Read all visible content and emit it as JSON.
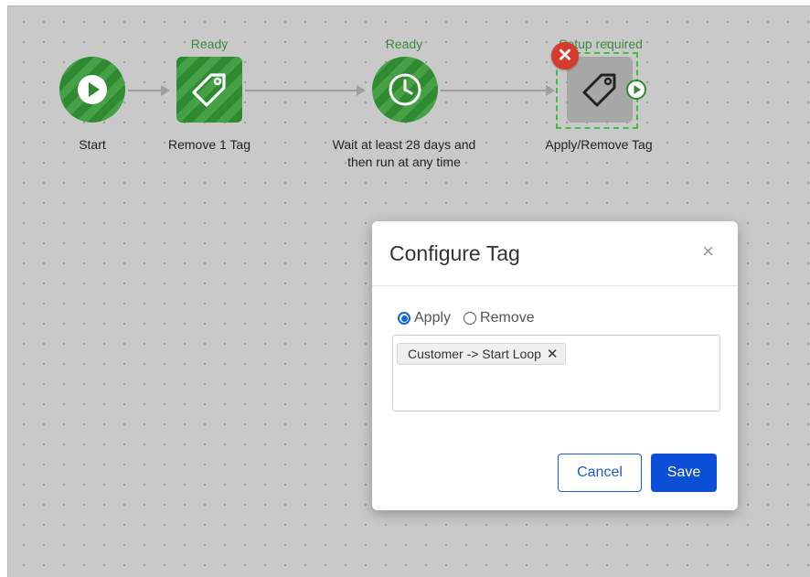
{
  "workflow": {
    "nodes": [
      {
        "status": "",
        "label": "Start",
        "icon": "play-icon"
      },
      {
        "status": "Ready",
        "label": "Remove 1 Tag",
        "icon": "tag-icon"
      },
      {
        "status": "Ready",
        "label_line1": "Wait at least 28 days and",
        "label_line2": "then run at any time",
        "icon": "clock-icon"
      },
      {
        "status": "Setup required",
        "label": "Apply/Remove Tag",
        "icon": "tag-icon"
      }
    ],
    "error_badge": "✕"
  },
  "colors": {
    "success_green": "#2f8a32",
    "status_green": "#3c8a3c",
    "error_red": "#d63b2d",
    "primary_blue": "#0b4fd6"
  },
  "modal": {
    "title": "Configure Tag",
    "close_glyph": "×",
    "options": {
      "apply": "Apply",
      "remove": "Remove",
      "selected": "apply"
    },
    "tags": [
      {
        "text": "Customer -> Start Loop",
        "remove_glyph": "✕"
      }
    ],
    "cancel_label": "Cancel",
    "save_label": "Save"
  }
}
